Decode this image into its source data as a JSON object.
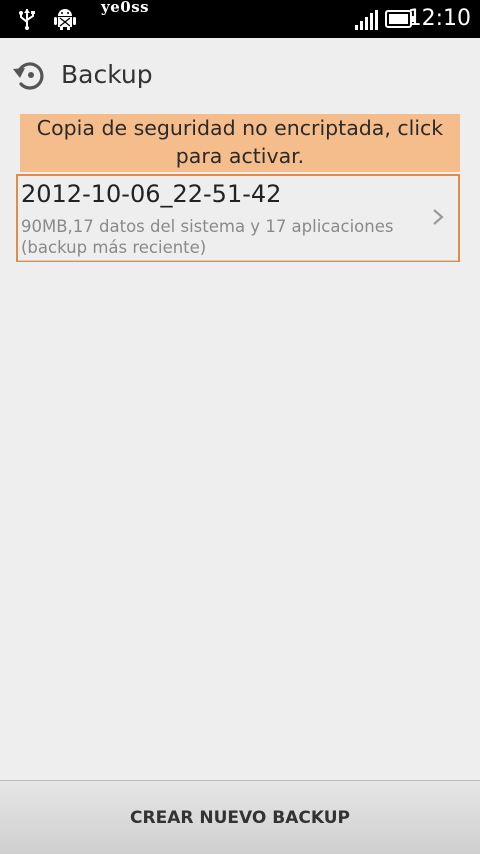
{
  "status_bar": {
    "time": "12:10",
    "watermark": "ye0ss",
    "icons": [
      "usb-icon",
      "android-debug-icon",
      "signal-icon",
      "battery-icon"
    ]
  },
  "header": {
    "title": "Backup",
    "icon": "backup-restore-icon"
  },
  "banner": {
    "text": "Copia de seguridad no encriptada, click para activar."
  },
  "backups": [
    {
      "name": "2012-10-06_22-51-42",
      "details": "90MB,17 datos del sistema y 17 aplicaciones",
      "note": "(backup más reciente)",
      "icon": "chevron-right-icon"
    }
  ],
  "actions": {
    "create_label": "CREAR NUEVO BACKUP"
  },
  "colors": {
    "banner_bg": "#f6bd8c",
    "item_border": "#e28a4a",
    "background": "#eeeeee",
    "status_bar_bg": "#000000"
  }
}
